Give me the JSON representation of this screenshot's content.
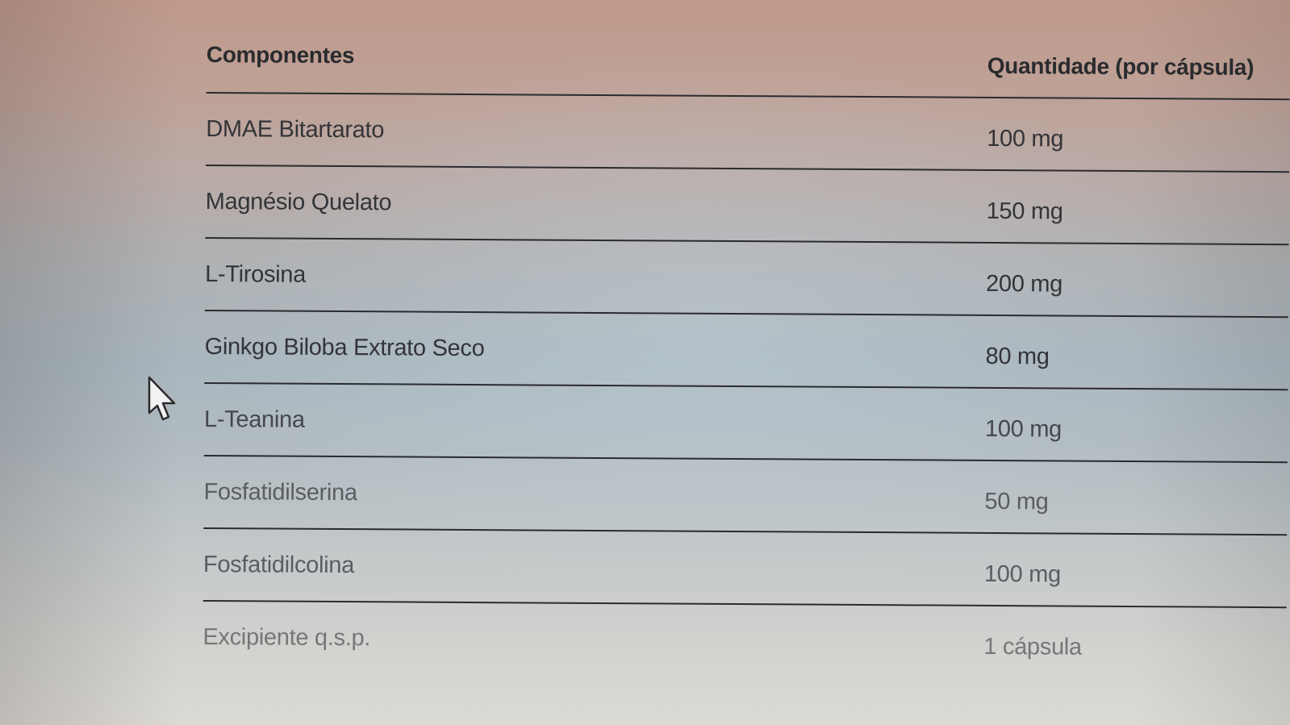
{
  "table": {
    "headers": {
      "component": "Componentes",
      "quantity": "Quantidade (por cápsula)"
    },
    "rows": [
      {
        "component": "DMAE Bitartarato",
        "quantity": "100 mg"
      },
      {
        "component": "Magnésio Quelato",
        "quantity": "150 mg"
      },
      {
        "component": "L-Tirosina",
        "quantity": "200 mg"
      },
      {
        "component": "Ginkgo Biloba Extrato Seco",
        "quantity": "80 mg"
      },
      {
        "component": "L-Teanina",
        "quantity": "100 mg"
      },
      {
        "component": "Fosfatidilserina",
        "quantity": "50 mg"
      },
      {
        "component": "Fosfatidilcolina",
        "quantity": "100 mg"
      },
      {
        "component": "Excipiente q.s.p.",
        "quantity": "1 cápsula"
      }
    ]
  },
  "cursor": {
    "icon": "mouse-pointer-arrow-icon"
  }
}
